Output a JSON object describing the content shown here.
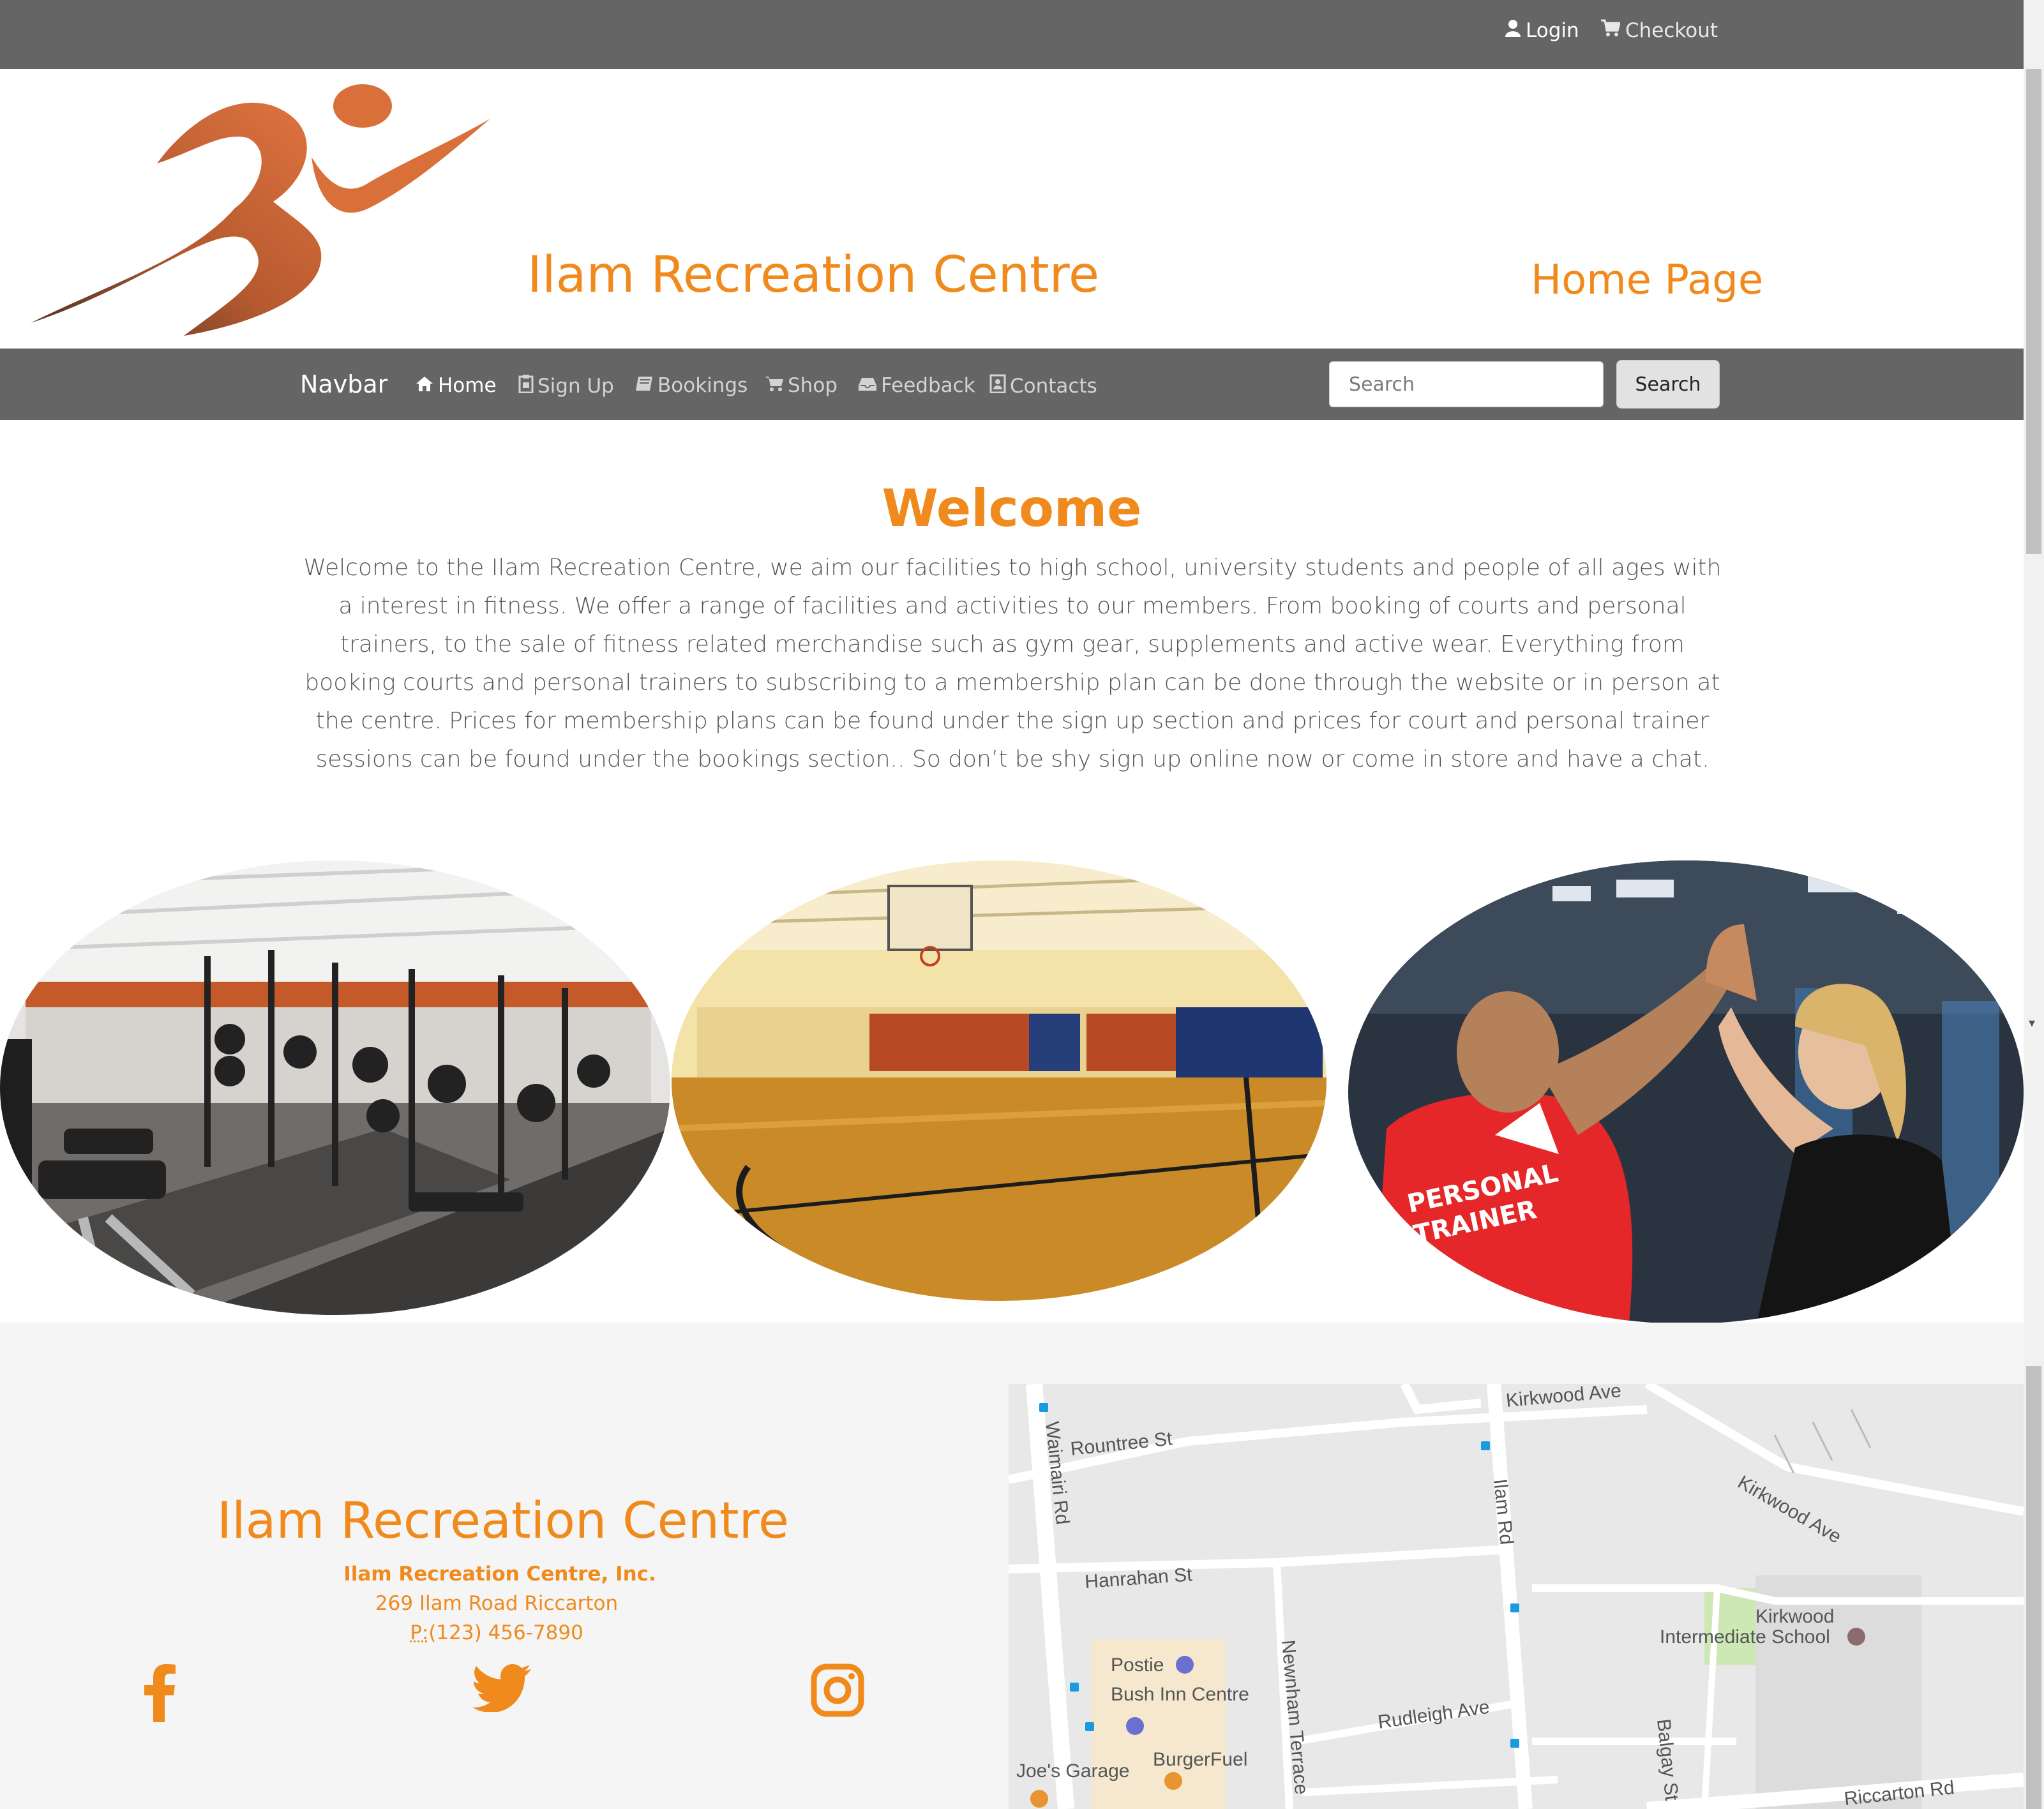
{
  "topbar": {
    "login_label": "Login",
    "checkout_label": "Checkout"
  },
  "header": {
    "brand_title": "Ilam Recreation Centre",
    "page_title": "Home Page"
  },
  "navbar": {
    "brand": "Navbar",
    "items": [
      {
        "label": "Home",
        "icon": "home-icon",
        "active": true
      },
      {
        "label": "Sign Up",
        "icon": "clipboard-icon"
      },
      {
        "label": "Bookings",
        "icon": "book-icon"
      },
      {
        "label": "Shop",
        "icon": "cart-icon"
      },
      {
        "label": "Feedback",
        "icon": "inbox-icon"
      },
      {
        "label": "Contacts",
        "icon": "contact-icon"
      }
    ],
    "search_placeholder": "Search",
    "search_button": "Search"
  },
  "welcome": {
    "heading": "Welcome",
    "text": "Welcome to the Ilam Recreation Centre, we aim our facilities to high school, university students and people of all ages with a interest in fitness. We offer a range of facilities and activities to our members. From booking of courts and personal trainers, to the sale of fitness related merchandise such as gym gear, supplements and active wear. Everything from booking courts and personal trainers to subscribing to a membership plan can be done through the website or in person at the centre. Prices for membership plans can be found under the sign up section and prices for court and personal trainer sessions can be found under the bookings section.. So don’t be shy sign up online now or come in store and have a chat."
  },
  "photos": {
    "trainer_shirt_text_1": "PERSONAL",
    "trainer_shirt_text_2": "TRAINER"
  },
  "footer": {
    "title": "Ilam Recreation Centre",
    "company": "Ilam Recreation Centre, Inc.",
    "address": "269 Ilam Road Riccarton",
    "phone_prefix": "P:",
    "phone": "(123) 456-7890"
  },
  "map": {
    "labels": {
      "kirkwood_ave_top": "Kirkwood Ave",
      "rountree": "Rountree St",
      "waimairi": "Waimairi Rd",
      "ilam": "Ilam Rd",
      "kirkwood_ave_right": "Kirkwood Ave",
      "hanrahan": "Hanrahan St",
      "kirkwood_school_1": "Kirkwood",
      "kirkwood_school_2": "Intermediate School",
      "postie": "Postie",
      "bush_inn": "Bush Inn Centre",
      "newnham": "Newnham Terrace",
      "rudleigh": "Rudleigh Ave",
      "burgerfuel": "BurgerFuel",
      "joes_garage": "Joe's Garage",
      "balgay": "Balgay St",
      "riccarton": "Riccarton Rd"
    }
  },
  "colors": {
    "accent": "#f08a1c",
    "bar": "#656565",
    "logo": "#d9703a"
  }
}
